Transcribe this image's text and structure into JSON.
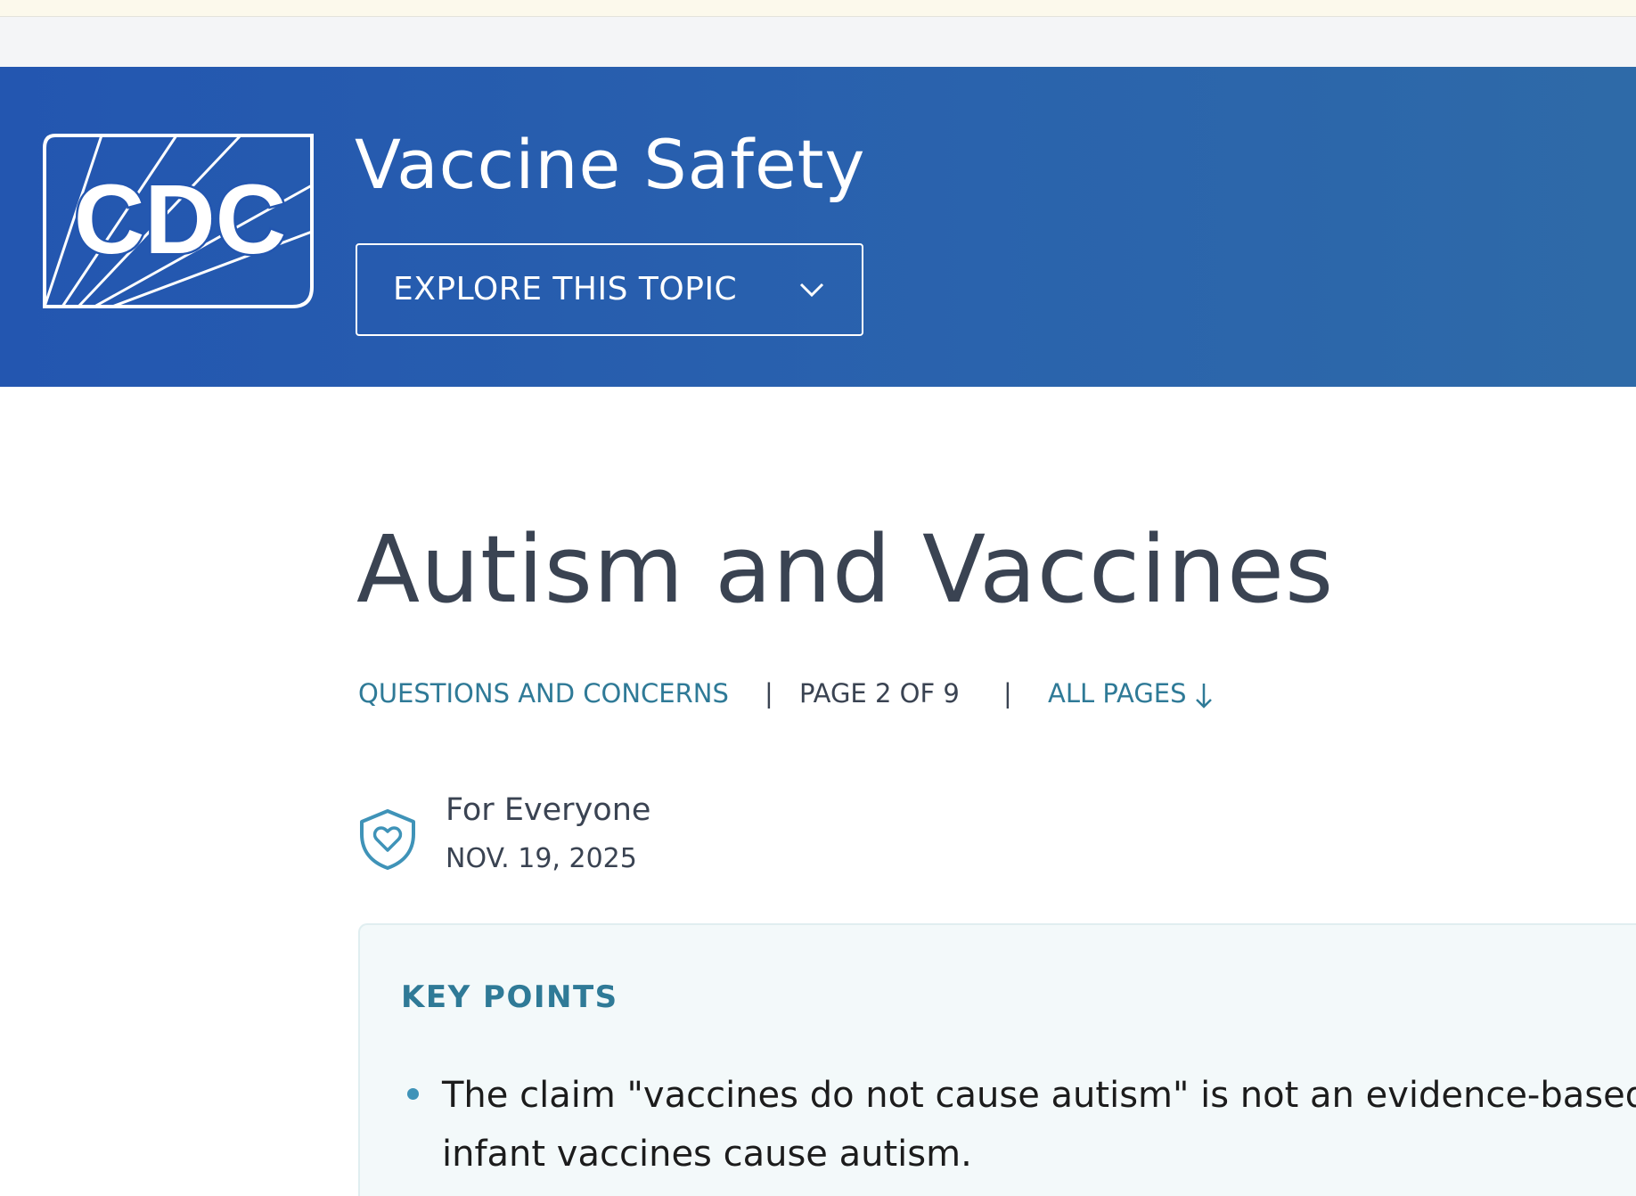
{
  "header": {
    "logo_text": "CDC",
    "site_title": "Vaccine Safety",
    "explore_label": "EXPLORE THIS TOPIC",
    "explore_icon": "chevron-down-icon",
    "background_color": "#2356b0"
  },
  "page": {
    "title": "Autism and Vaccines",
    "breadcrumb": {
      "section_link": "QUESTIONS AND CONCERNS",
      "separator": "|",
      "page_indicator": "PAGE 2 OF 9",
      "all_pages_link": "ALL PAGES",
      "all_pages_icon": "arrow-down-icon"
    },
    "audience": {
      "icon": "shield-heart-icon",
      "label": "For Everyone",
      "date": "NOV. 19, 2025"
    },
    "key_points": {
      "heading": "KEY POINTS",
      "items": [
        {
          "line1": "The claim \"vaccines do not cause autism\" is not an evidence-based c",
          "line2": "infant vaccines cause autism."
        }
      ]
    }
  },
  "colors": {
    "link": "#2f7a97",
    "text": "#3a4352",
    "panel_background": "#f3f9fa",
    "bullet": "#3f93b8"
  }
}
